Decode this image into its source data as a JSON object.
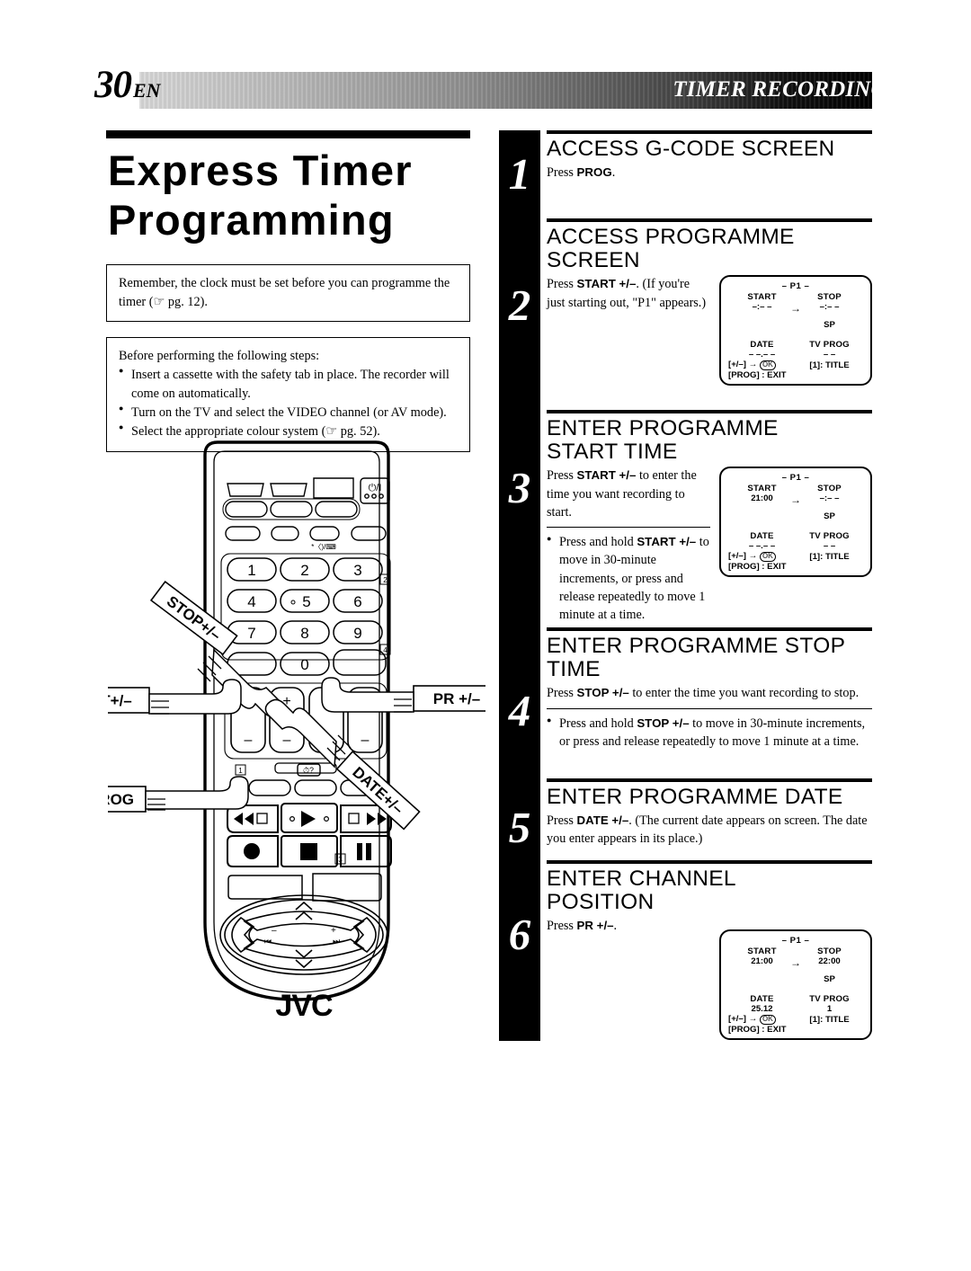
{
  "header": {
    "page_number": "30",
    "language_code": "EN",
    "section_title": "TIMER RECORDING (cont.)"
  },
  "left": {
    "doc_title": "Express Timer Programming",
    "note_1": "Remember, the clock must be set before you can programme the timer (☞ pg. 12).",
    "note_2_intro": "Before performing the following steps:",
    "note_2_items": [
      "Insert a cassette with the safety tab in place. The recorder will come on automatically.",
      "Turn on the TV and select the VIDEO channel (or AV mode).",
      "Select the appropriate colour system (☞ pg. 52)."
    ]
  },
  "remote": {
    "brand": "JVC",
    "callouts": [
      {
        "label": "STOP+/–"
      },
      {
        "label": "START+/–"
      },
      {
        "label": "PR +/–"
      },
      {
        "label": "DATE+/–"
      },
      {
        "label": "PROG"
      }
    ],
    "keypad": [
      "1",
      "2",
      "3",
      "4",
      "5",
      "6",
      "7",
      "8",
      "9",
      "0"
    ],
    "markers": [
      "1",
      "2",
      "3",
      "4"
    ],
    "power_glyph": "⏻/I",
    "transport": [
      "rewind",
      "play",
      "fast-forward",
      "record",
      "stop",
      "pause"
    ]
  },
  "steps": [
    {
      "number": "1",
      "heading": "ACCESS G-CODE SCREEN",
      "body_pre": "Press ",
      "body_bold": "PROG",
      "body_post": ".",
      "screen": null
    },
    {
      "number": "2",
      "heading": "ACCESS PROGRAMME\nSCREEN",
      "body_pre": "Press ",
      "body_bold": "START +/–",
      "body_post": ". (If you're just starting out, \"P1\" appears.)",
      "screen": {
        "p1": "– P1 –",
        "start_label": "START",
        "stop_label": "STOP",
        "start_value": "–:– –",
        "stop_value": "–:– –",
        "arrow": "→",
        "speed": "SP",
        "date_label": "DATE",
        "tvprog_label": "TV PROG",
        "date_value": "– –.– –",
        "tvprog_value": "– –",
        "hint_left": "[+/–] →",
        "hint_ok": "OK",
        "hint_right": "[1]: TITLE",
        "hint_exit": "[PROG] : EXIT"
      }
    },
    {
      "number": "3",
      "heading": "ENTER PROGRAMME\nSTART TIME",
      "body_pre": "Press ",
      "body_bold": "START +/–",
      "body_post": " to enter the time you want recording to start.",
      "bullet_pre": "Press and hold ",
      "bullet_bold": "START +/–",
      "bullet_post": " to move in 30-minute increments, or press and release repeatedly to move 1 minute at a time.",
      "screen": {
        "p1": "– P1 –",
        "start_label": "START",
        "stop_label": "STOP",
        "start_value": "21:00",
        "stop_value": "–:– –",
        "arrow": "→",
        "speed": "SP",
        "date_label": "DATE",
        "tvprog_label": "TV PROG",
        "date_value": "– –.– –",
        "tvprog_value": "– –",
        "hint_left": "[+/–] →",
        "hint_ok": "OK",
        "hint_right": "[1]: TITLE",
        "hint_exit": "[PROG] : EXIT"
      }
    },
    {
      "number": "4",
      "heading": "ENTER PROGRAMME STOP\nTIME",
      "body_pre": "Press ",
      "body_bold": "STOP +/–",
      "body_post": " to enter the time you want recording to stop.",
      "bullet_pre": "Press and hold ",
      "bullet_bold": "STOP +/–",
      "bullet_post": " to move in 30-minute increments, or press and release repeatedly to move 1 minute at a time.",
      "screen": null
    },
    {
      "number": "5",
      "heading": "ENTER PROGRAMME DATE",
      "body_pre": "Press ",
      "body_bold": "DATE +/–",
      "body_post": ". (The current date appears on screen. The date you enter appears in its place.)",
      "screen": null
    },
    {
      "number": "6",
      "heading": "ENTER CHANNEL\nPOSITION",
      "body_pre": "Press ",
      "body_bold": "PR +/–",
      "body_post": ".",
      "screen": {
        "p1": "– P1 –",
        "start_label": "START",
        "stop_label": "STOP",
        "start_value": "21:00",
        "stop_value": "22:00",
        "arrow": "→",
        "speed": "SP",
        "date_label": "DATE",
        "tvprog_label": "TV PROG",
        "date_value": "25.12",
        "tvprog_value": "1",
        "hint_left": "[+/–] →",
        "hint_ok": "OK",
        "hint_right": "[1]: TITLE",
        "hint_exit": "[PROG] : EXIT"
      }
    }
  ]
}
